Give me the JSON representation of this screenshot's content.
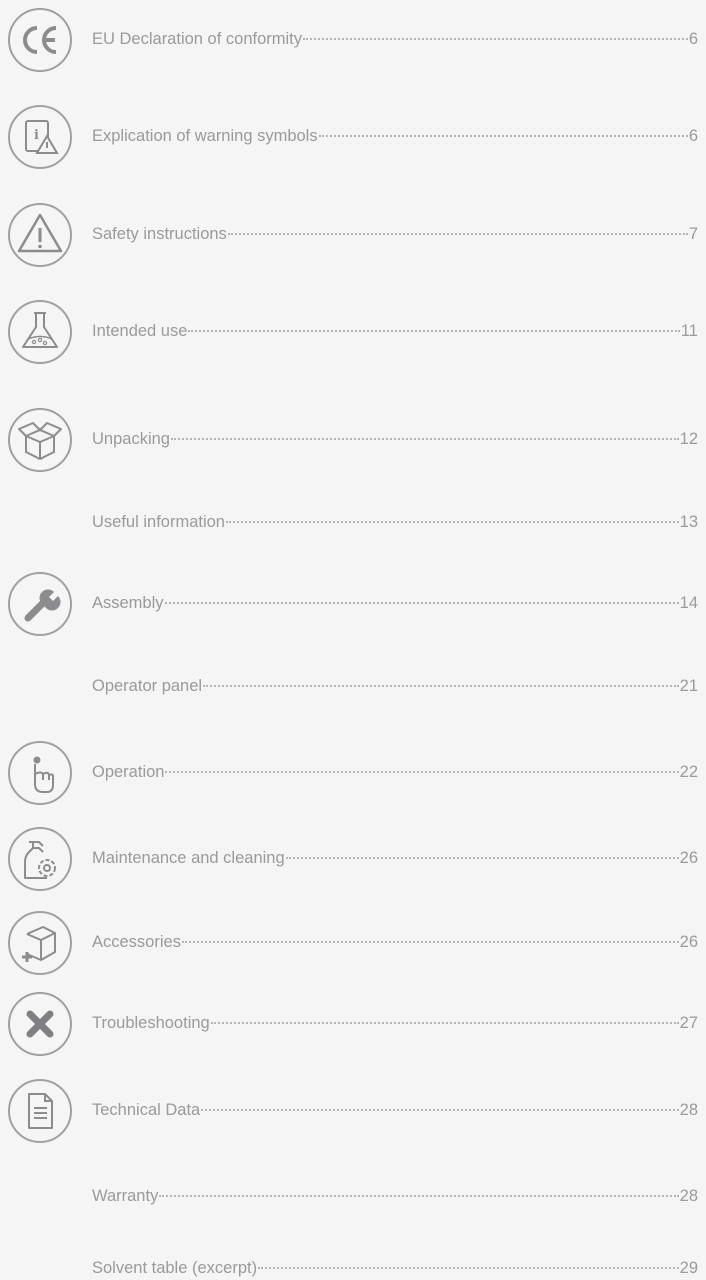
{
  "toc": [
    {
      "icon": "ce-mark-icon",
      "title": "EU Declaration of conformity",
      "page": "6"
    },
    {
      "icon": "info-warning-manual-icon",
      "title": "Explication of warning symbols",
      "page": "6"
    },
    {
      "icon": "warning-triangle-icon",
      "title": "Safety instructions",
      "page": "7"
    },
    {
      "icon": "lab-flask-icon",
      "title": "Intended use",
      "page": "11"
    },
    {
      "icon": "open-box-icon",
      "title": "Unpacking",
      "page": "12"
    },
    {
      "icon": "",
      "title": "Useful information",
      "page": "13"
    },
    {
      "icon": "wrench-icon",
      "title": "Assembly",
      "page": "14"
    },
    {
      "icon": "",
      "title": "Operator panel",
      "page": "21"
    },
    {
      "icon": "touch-finger-icon",
      "title": "Operation",
      "page": "22"
    },
    {
      "icon": "spray-bottle-gear-icon",
      "title": "Maintenance and cleaning",
      "page": "26"
    },
    {
      "icon": "box-plus-icon",
      "title": "Accessories",
      "page": "26"
    },
    {
      "icon": "x-mark-icon",
      "title": "Troubleshooting",
      "page": "27"
    },
    {
      "icon": "document-icon",
      "title": "Technical Data",
      "page": "28"
    },
    {
      "icon": "",
      "title": "Warranty",
      "page": "28"
    },
    {
      "icon": "",
      "title": "Solvent table (excerpt)",
      "page": "29"
    }
  ],
  "colors": {
    "text": "#9a9a9c",
    "background": "#f5f5f6",
    "icon_stroke": "#a0a0a2"
  }
}
